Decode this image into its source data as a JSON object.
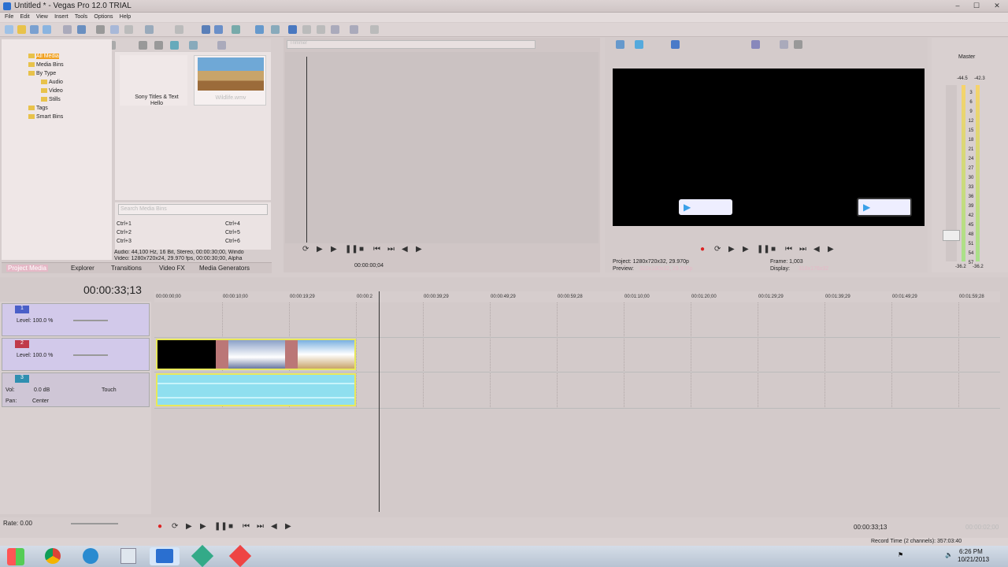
{
  "window": {
    "title": "Untitled * - Vegas Pro 12.0 TRIAL",
    "controls": [
      "–",
      "☐",
      "✕"
    ]
  },
  "menu": [
    "File",
    "Edit",
    "View",
    "Insert",
    "Tools",
    "Options",
    "Help"
  ],
  "explorer": {
    "tree": [
      {
        "label": "All Media",
        "indent": 0,
        "selected": true
      },
      {
        "label": "Media Bins",
        "indent": 0
      },
      {
        "label": "By Type",
        "indent": 1
      },
      {
        "label": "Audio",
        "indent": 2
      },
      {
        "label": "Video",
        "indent": 2
      },
      {
        "label": "Stills",
        "indent": 2
      },
      {
        "label": "Tags",
        "indent": 1
      },
      {
        "label": "Smart Bins",
        "indent": 1
      }
    ],
    "media": [
      {
        "label": "Sony Titles & Text\nHello"
      },
      {
        "label": "Wildlife.wmv"
      }
    ],
    "search_placeholder": "Search Media Bins",
    "shortcuts": [
      "Ctrl+1",
      "Ctrl+4",
      "Ctrl+2",
      "Ctrl+5",
      "Ctrl+3",
      "Ctrl+6"
    ],
    "info_audio": "Audio: 44,100 Hz, 16 Bit, Stereo, 00:00:30;00, Windo",
    "info_video": "Video: 1280x720x24, 29.970 fps, 00:00:30;00, Alpha",
    "tabs": [
      "Project Media",
      "Explorer",
      "Transitions",
      "Video FX",
      "Media Generators"
    ]
  },
  "trimmer": {
    "time": "00:00:00;04",
    "dropdown": "Trimmer"
  },
  "preview": {
    "project": "Project:   1280x720x32, 29.970p",
    "preview_label": "Preview:",
    "preview_value": "320x180x32, 29.970p",
    "frame": "Frame:      1,003",
    "display_label": "Display:",
    "display_value": "318x176x32"
  },
  "master": {
    "title": "Master",
    "left": "-44.5",
    "right": "-42.3",
    "bottom_left": "-36.2",
    "bottom_right": "-36.2",
    "scale": [
      "3",
      "6",
      "9",
      "12",
      "15",
      "18",
      "21",
      "24",
      "27",
      "30",
      "33",
      "36",
      "39",
      "42",
      "45",
      "48",
      "51",
      "54",
      "57"
    ]
  },
  "timeline": {
    "timecode": "00:00:33;13",
    "ruler": [
      "00:00:00;00",
      "00:00:10;00",
      "00:00:19;29",
      "00:00:2",
      "00:00:39;29",
      "00:00:49;29",
      "00:00:59;28",
      "00:01:10;00",
      "00:01:20;00",
      "00:01:29;29",
      "00:01:39;29",
      "00:01:49;29",
      "00:01:59;28"
    ],
    "tracks": [
      {
        "num": "1",
        "level": "Level: 100.0 %"
      },
      {
        "num": "2",
        "level": "Level: 100.0 %"
      },
      {
        "num": "3",
        "vol_label": "Vol:",
        "vol": "0.0 dB",
        "pan_label": "Pan:",
        "pan": "Center",
        "mode": "Touch"
      }
    ],
    "rate": "Rate: 0.00",
    "cursor_time": "00:00:33;13",
    "end_time": "00:00:02;00",
    "record_time": "Record Time (2 channels): 357:03:40"
  },
  "taskbar": {
    "time": "6:26 PM",
    "date": "10/21/2013"
  },
  "colors": {
    "accent": "#2a6fd0",
    "clip_border": "#e8e85a",
    "audio": "#8fdfef"
  }
}
